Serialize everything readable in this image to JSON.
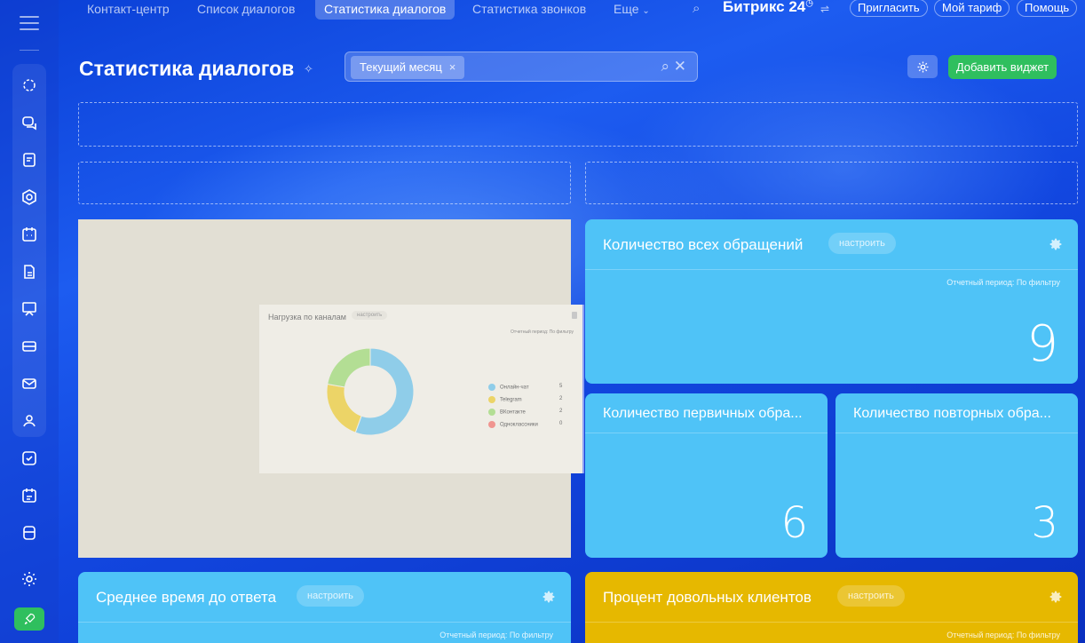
{
  "nav": {
    "items": [
      "Контакт-центр",
      "Список диалогов",
      "Статистика диалогов",
      "Статистика звонков",
      "Еще"
    ],
    "brand": "Битрикс",
    "brand_num": "24",
    "invite": "Пригласить",
    "tariff": "Мой тариф",
    "help": "Помощь"
  },
  "header": {
    "title": "Статистика диалогов",
    "filter_tag": "Текущий месяц",
    "add_widget": "Добавить виджет"
  },
  "channels_widget": {
    "title": "Нагрузка по каналам",
    "configure": "настроить",
    "period": "Отчетный период: По фильтру"
  },
  "chart_data": {
    "type": "pie",
    "title": "Нагрузка по каналам",
    "categories": [
      "Онлайн-чат",
      "Telegram",
      "ВКонтакте",
      "Одноклассники"
    ],
    "values": [
      5,
      2,
      2,
      0
    ],
    "colors": [
      "#8fcde9",
      "#ecd467",
      "#b3de94",
      "#f09590"
    ],
    "donut": true,
    "legend": "right"
  },
  "widgets": {
    "all_requests": {
      "title": "Количество всех обращений",
      "configure": "настроить",
      "period": "Отчетный период: По фильтру",
      "value": "9"
    },
    "primary": {
      "title": "Количество первичных обра...",
      "value": "6"
    },
    "repeat": {
      "title": "Количество повторных обра...",
      "value": "3"
    },
    "avg_time": {
      "title": "Среднее время до ответа",
      "configure": "настроить",
      "period": "Отчетный период: По фильтру"
    },
    "satisfied": {
      "title": "Процент довольных клиентов",
      "configure": "настроить",
      "period": "Отчетный период: По фильтру"
    }
  },
  "colors": {
    "accent_green": "#2fbf5e",
    "widget_blue": "#4fc3f7",
    "widget_yellow": "#e6b800"
  }
}
